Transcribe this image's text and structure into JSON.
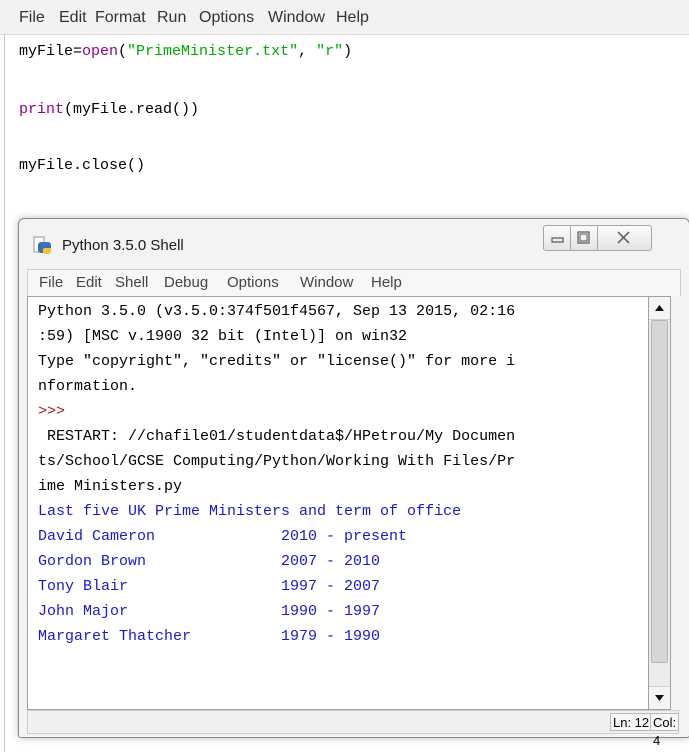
{
  "editor": {
    "menu": [
      "File",
      "Edit",
      "Format",
      "Run",
      "Options",
      "Window",
      "Help"
    ],
    "code": {
      "line1": {
        "var": "myFile=",
        "func": "open",
        "open_paren": "(",
        "arg1": "\"PrimeMinister.txt\"",
        "sep": ", ",
        "arg2": "\"r\"",
        "close_paren": ")"
      },
      "line2": {
        "func": "print",
        "rest": "(myFile.read())"
      },
      "line3": "myFile.close()"
    }
  },
  "shell": {
    "title": "Python 3.5.0 Shell",
    "menu": [
      "File",
      "Edit",
      "Shell",
      "Debug",
      "Options",
      "Window",
      "Help"
    ],
    "output": {
      "banner": [
        "Python 3.5.0 (v3.5.0:374f501f4567, Sep 13 2015, 02:16",
        ":59) [MSC v.1900 32 bit (Intel)] on win32",
        "Type \"copyright\", \"credits\" or \"license()\" for more i",
        "nformation."
      ],
      "prompt": ">>>",
      "restart": [
        " RESTART: //chafile01/studentdata$/HPetrou/My Documen",
        "ts/School/GCSE Computing/Python/Working With Files/Pr",
        "ime Ministers.py"
      ],
      "file_lines": [
        "Last five UK Prime Ministers and term of office",
        "David Cameron              2010 - present",
        "Gordon Brown               2007 - 2010",
        "Tony Blair                 1997 - 2007",
        "John Major                 1990 - 1997",
        "Margaret Thatcher          1979 - 1990"
      ]
    },
    "status": {
      "line": "Ln: 12",
      "col": "Col: 4"
    }
  },
  "colors": {
    "keyword": "#900090",
    "string": "#00aa00",
    "output_blue": "#1a1acc",
    "prompt": "#a01c1c"
  },
  "icons": [
    "python-icon",
    "minimize-icon",
    "maximize-icon",
    "close-icon",
    "scroll-up-icon",
    "scroll-down-icon"
  ]
}
